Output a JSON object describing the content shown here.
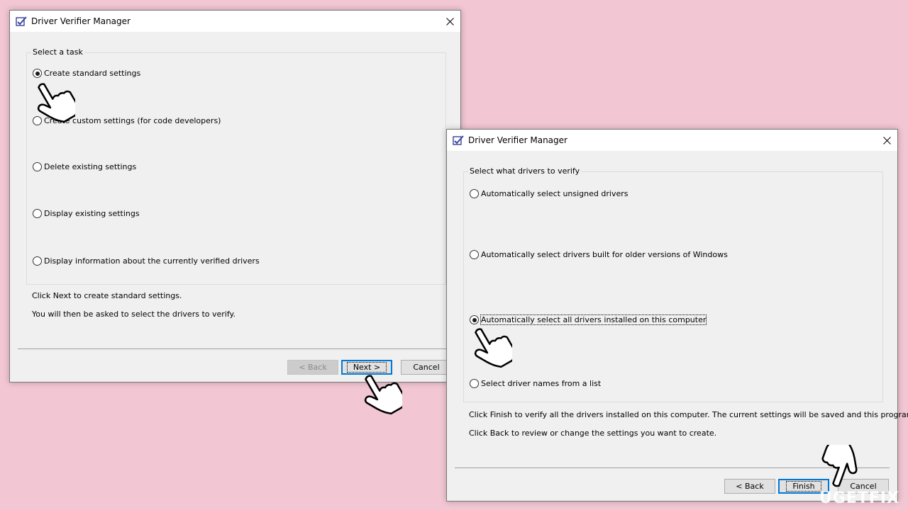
{
  "colors": {
    "background": "#f2c6d3",
    "window": "#f0f0f0",
    "focus": "#0078d7"
  },
  "window1": {
    "title": "Driver Verifier Manager",
    "group_label": "Select a task",
    "options": [
      {
        "label": "Create standard settings",
        "checked": true
      },
      {
        "label": "Create custom settings (for code developers)",
        "checked": false
      },
      {
        "label": "Delete existing settings",
        "checked": false
      },
      {
        "label": "Display existing settings",
        "checked": false
      },
      {
        "label": "Display information about the currently verified drivers",
        "checked": false
      }
    ],
    "info_line1": "Click Next to create standard settings.",
    "info_line2": "You will then be asked to select the drivers to verify.",
    "back_label": "< Back",
    "next_label": "Next >",
    "cancel_label": "Cancel"
  },
  "window2": {
    "title": "Driver Verifier Manager",
    "group_label": "Select what drivers to verify",
    "options": [
      {
        "label": "Automatically select unsigned drivers",
        "checked": false
      },
      {
        "label": "Automatically select drivers built for older versions of Windows",
        "checked": false
      },
      {
        "label": "Automatically select all drivers installed on this computer",
        "checked": true
      },
      {
        "label": "Select driver names from a list",
        "checked": false
      }
    ],
    "info_line1": "Click Finish to verify all the drivers installed on this computer. The current settings will be saved and this program will exit.",
    "info_line2": "Click Back to review or change the settings you want to create.",
    "back_label": "< Back",
    "finish_label": "Finish",
    "cancel_label": "Cancel"
  },
  "watermark": "UGETFIX",
  "icons": {
    "app": "driver-verifier-icon",
    "close": "close-icon",
    "pointer": "hand-pointer-icon"
  }
}
